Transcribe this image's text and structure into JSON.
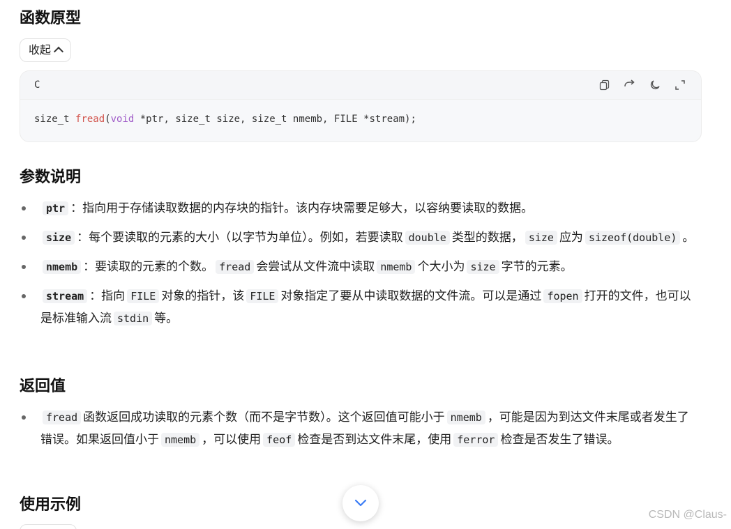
{
  "sections": {
    "prototype_title": "函数原型",
    "params_title": "参数说明",
    "return_title": "返回值",
    "example_title": "使用示例"
  },
  "collapse_button": {
    "label": "收起"
  },
  "code_block": {
    "language": "C",
    "tools": [
      "copy-icon",
      "wrap-icon",
      "theme-icon",
      "expand-icon"
    ],
    "code_parts": {
      "p1": "size_t ",
      "fn": "fread",
      "p2": "(",
      "type": "void",
      "p3": " *ptr, size_t size, size_t nmemb, FILE *stream);"
    }
  },
  "params": [
    {
      "name": "ptr",
      "t1": "：指向用于存储读取数据的内存块的指针。该内存块需要足够大，以容纳要读取的数据。"
    },
    {
      "name": "size",
      "t1": "：每个要读取的元素的大小（以字节为单位）。例如，若要读取",
      "c1": "double",
      "t2": "类型的数据，",
      "c2": "size",
      "t3": "应为",
      "c3": "sizeof(double)",
      "t4": "。"
    },
    {
      "name": "nmemb",
      "t1": "：要读取的元素的个数。",
      "c1": "fread",
      "t2": "会尝试从文件流中读取",
      "c2": "nmemb",
      "t3": "个大小为",
      "c3": "size",
      "t4": "字节的元素。"
    },
    {
      "name": "stream",
      "t1": "：指向",
      "c1": "FILE",
      "t2": "对象的指针，该",
      "c2": "FILE",
      "t3": "对象指定了要从中读取数据的文件流。可以是通过",
      "c3": "fopen",
      "t4": "打开的文件，也可以是标准输入流",
      "c4": "stdin",
      "t5": "等。"
    }
  ],
  "return_value": {
    "c1": "fread",
    "t1": "函数返回成功读取的元素个数（而不是字节数）。这个返回值可能小于",
    "c2": "nmemb",
    "t2": "，可能是因为到达文件末尾或者发生了错误。如果返回值小于",
    "c3": "nmemb",
    "t3": "，可以使用",
    "c4": "feof",
    "t4": "检查是否到达文件末尾，使用",
    "c5": "ferror",
    "t5": "检查是否发生了错误。"
  },
  "scroll_button": {
    "icon": "chevron-down-icon"
  },
  "watermark": "CSDN @Claus-"
}
